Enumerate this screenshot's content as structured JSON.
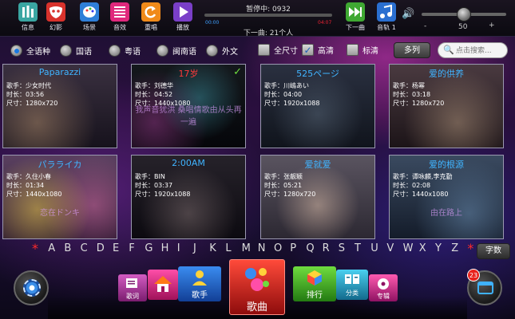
{
  "toolbar": {
    "buttons": [
      {
        "label": "信息",
        "icon": "info-bars-icon",
        "color": "#3aa6a2"
      },
      {
        "label": "幻影",
        "icon": "mask-icon",
        "color": "#d8322c"
      },
      {
        "label": "场景",
        "icon": "palette-icon",
        "color": "#2f7fd8"
      },
      {
        "label": "音效",
        "icon": "equalizer-icon",
        "color": "#e0287c"
      },
      {
        "label": "重唱",
        "icon": "replay-icon",
        "color": "#f08a1a"
      },
      {
        "label": "播放",
        "icon": "play-icon",
        "color": "#7a3fc8"
      }
    ],
    "status": "暂停中: 0932",
    "time_start": "00:00",
    "time_end": "04:07",
    "progress_fraction": 0.0,
    "next_song": "下一曲: 21个人",
    "right_buttons": [
      {
        "label": "下一曲",
        "icon": "next-track-icon",
        "color": "#3fa832"
      },
      {
        "label": "音轨 1",
        "icon": "audio-track-icon",
        "color": "#2a6fd0"
      }
    ],
    "volume": {
      "minus": "-",
      "value": "50",
      "plus": "+",
      "fraction": 0.5
    }
  },
  "filters": {
    "radios": [
      {
        "label": "全语种",
        "selected": true
      },
      {
        "label": "国语",
        "selected": false
      },
      {
        "label": "粤语",
        "selected": false
      },
      {
        "label": "闽南语",
        "selected": false
      },
      {
        "label": "外文",
        "selected": false
      }
    ],
    "checks": [
      {
        "label": "全尺寸",
        "checked": false
      },
      {
        "label": "高清",
        "checked": true
      },
      {
        "label": "标清",
        "checked": false
      }
    ],
    "multi_label": "多列",
    "search_placeholder": "点击搜索..."
  },
  "songs": [
    {
      "title": "Paparazzi",
      "singer": "歌手：少女时代",
      "duration": "时长：03:56",
      "size": "尺寸：1280x720",
      "title_color": "#40b4ff",
      "playing": false,
      "subtitle": ""
    },
    {
      "title": "17岁",
      "singer": "歌手：刘德华",
      "duration": "时长：04:52",
      "size": "尺寸：1440x1080",
      "title_color": "#ff3a3a",
      "playing": true,
      "subtitle": "我声音犹洪\n桑唱情歌由从头再一遍"
    },
    {
      "title": "525ページ",
      "singer": "歌手：川嶋あい",
      "duration": "时长：04:00",
      "size": "尺寸：1920x1088",
      "title_color": "#40b4ff",
      "playing": false,
      "subtitle": ""
    },
    {
      "title": "爱的供养",
      "singer": "歌手：杨幂",
      "duration": "时长：03:18",
      "size": "尺寸：1280x720",
      "title_color": "#40b4ff",
      "playing": false,
      "subtitle": ""
    },
    {
      "title": "パラライカ",
      "singer": "歌手：久住小春",
      "duration": "时长：01:34",
      "size": "尺寸：1440x1080",
      "title_color": "#40b4ff",
      "playing": false,
      "subtitle": "恋在ドンキ"
    },
    {
      "title": "2:00AM",
      "singer": "歌手：BIN",
      "duration": "时长：03:37",
      "size": "尺寸：1920x1088",
      "title_color": "#40b4ff",
      "playing": false,
      "subtitle": ""
    },
    {
      "title": "爱就爱",
      "singer": "歌手：张靓颖",
      "duration": "时长：05:21",
      "size": "尺寸：1280x720",
      "title_color": "#40b4ff",
      "playing": false,
      "subtitle": ""
    },
    {
      "title": "爱的根源",
      "singer": "歌手：谭咏麟,李克勤",
      "duration": "时长：02:08",
      "size": "尺寸：1440x1080",
      "title_color": "#40b4ff",
      "playing": false,
      "subtitle": "由在路上"
    }
  ],
  "alphabet": [
    "*",
    "A",
    "B",
    "C",
    "D",
    "E",
    "F",
    "G",
    "H",
    "I",
    "J",
    "K",
    "L",
    "M",
    "N",
    "O",
    "P",
    "Q",
    "R",
    "S",
    "T",
    "U",
    "V",
    "W",
    "X",
    "Y",
    "Z",
    "*"
  ],
  "zishu_label": "字数",
  "dock": {
    "inbox_badge": "23",
    "buttons": [
      {
        "key": "lyrics",
        "label": "歌词",
        "icon": "lyrics-icon",
        "color": "#b0349e"
      },
      {
        "key": "home",
        "label": "",
        "icon": "home-icon",
        "color": "#e0287c"
      },
      {
        "key": "singer",
        "label": "歌手",
        "icon": "singer-icon",
        "color": "#2a6ed8"
      },
      {
        "key": "songs",
        "label": "歌曲",
        "icon": "molecule-icon",
        "color": "#d8322c"
      },
      {
        "key": "ranking",
        "label": "排行",
        "icon": "cube-icon",
        "color": "#3fa832"
      },
      {
        "key": "category",
        "label": "分类",
        "icon": "category-icon",
        "color": "#2aa6c8"
      },
      {
        "key": "album",
        "label": "专辑",
        "icon": "album-icon",
        "color": "#d8328c"
      }
    ]
  }
}
